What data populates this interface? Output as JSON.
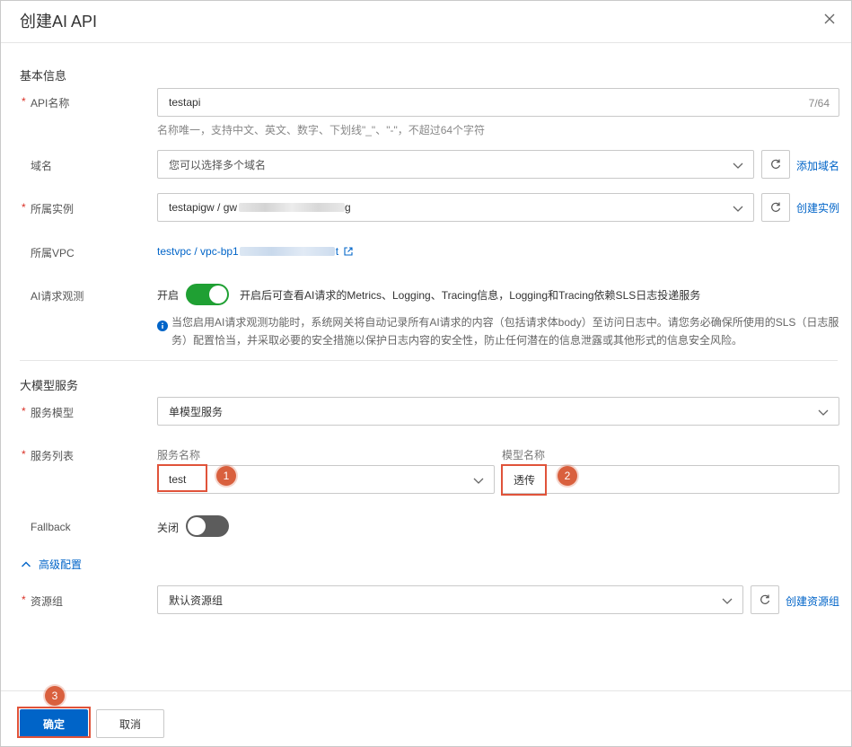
{
  "dialog": {
    "title": "创建AI API",
    "close_icon": "close-icon"
  },
  "basic": {
    "section_title": "基本信息",
    "api_name": {
      "label": "API名称",
      "value": "testapi",
      "count": "7/64",
      "hint": "名称唯一，支持中文、英文、数字、下划线\"_\"、\"-\"，不超过64个字符"
    },
    "domain": {
      "label": "域名",
      "placeholder": "您可以选择多个域名",
      "add_link": "添加域名"
    },
    "instance": {
      "label": "所属实例",
      "value_prefix": "testapigw / gw",
      "value_suffix": "g",
      "create_link": "创建实例"
    },
    "vpc": {
      "label": "所属VPC",
      "value_prefix": "testvpc / vpc-bp1",
      "value_suffix": "t"
    },
    "observe": {
      "label": "AI请求观测",
      "state_label": "开启",
      "enabled": true,
      "description": "开启后可查看AI请求的Metrics、Logging、Tracing信息，Logging和Tracing依赖SLS日志投递服务",
      "notice_line1": "当您启用AI请求观测功能时，系统网关将自动记录所有AI请求的内容（包括请求体body）至访问日志中。请您务必确保所使用的SLS（日志服",
      "notice_line2": "务）配置恰当，并采取必要的安全措施以保护日志内容的安全性，防止任何潜在的信息泄露或其他形式的信息安全风险。"
    }
  },
  "model": {
    "section_title": "大模型服务",
    "service_model": {
      "label": "服务模型",
      "value": "单模型服务"
    },
    "service_list": {
      "label": "服务列表",
      "service_name_header": "服务名称",
      "model_name_header": "模型名称",
      "service_name_value": "test",
      "model_name_value": "透传"
    },
    "fallback": {
      "label": "Fallback",
      "state_label": "关闭",
      "enabled": false
    },
    "advanced": {
      "label": "高级配置"
    },
    "resource_group": {
      "label": "资源组",
      "value": "默认资源组",
      "create_link": "创建资源组"
    }
  },
  "annotations": {
    "badge1": "1",
    "badge2": "2",
    "badge3": "3"
  },
  "footer": {
    "confirm": "确定",
    "cancel": "取消"
  },
  "colors": {
    "accent": "#0064c8",
    "toggle_on": "#1fa033",
    "toggle_off": "#5c5c5c",
    "marker": "#e0533a"
  }
}
